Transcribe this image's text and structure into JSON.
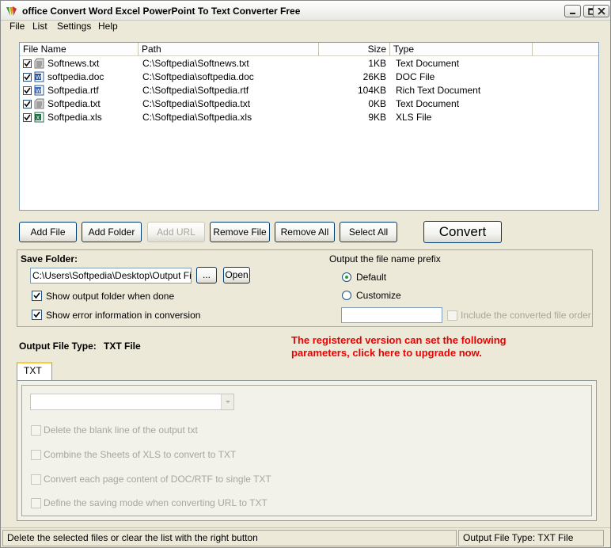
{
  "window": {
    "title": "office Convert Word Excel PowerPoint To Text Converter Free"
  },
  "menu": [
    "File",
    "List",
    "Settings",
    "Help"
  ],
  "file_list": {
    "columns": [
      "File Name",
      "Path",
      "Size",
      "Type"
    ],
    "rows": [
      {
        "name": "Softnews.txt",
        "path": "C:\\Softpedia\\Softnews.txt",
        "size": "1KB",
        "type": "Text Document",
        "icon": "text-file-icon",
        "checked": true
      },
      {
        "name": "softpedia.doc",
        "path": "C:\\Softpedia\\softpedia.doc",
        "size": "26KB",
        "type": "DOC File",
        "icon": "word-file-icon",
        "checked": true
      },
      {
        "name": "Softpedia.rtf",
        "path": "C:\\Softpedia\\Softpedia.rtf",
        "size": "104KB",
        "type": "Rich Text Document",
        "icon": "rtf-file-icon",
        "checked": true
      },
      {
        "name": "Softpedia.txt",
        "path": "C:\\Softpedia\\Softpedia.txt",
        "size": "0KB",
        "type": "Text Document",
        "icon": "text-file-icon",
        "checked": true
      },
      {
        "name": "Softpedia.xls",
        "path": "C:\\Softpedia\\Softpedia.xls",
        "size": "9KB",
        "type": "XLS File",
        "icon": "excel-file-icon",
        "checked": true
      }
    ]
  },
  "buttons": {
    "add_file": "Add File",
    "add_folder": "Add Folder",
    "add_url": "Add URL",
    "remove_file": "Remove File",
    "remove_all": "Remove All",
    "select_all": "Select All",
    "convert": "Convert"
  },
  "save_folder": {
    "label": "Save Folder:",
    "path": "C:\\Users\\Softpedia\\Desktop\\Output Files",
    "browse": "...",
    "open": "Open",
    "show_output": "Show output folder when done",
    "show_output_checked": true,
    "show_errors": "Show error information in conversion",
    "show_errors_checked": true
  },
  "prefix": {
    "label": "Output the file name prefix",
    "option_default": "Default",
    "option_customize": "Customize",
    "selected": "Default",
    "custom_value": "",
    "include_order": "Include the converted file order",
    "include_order_checked": false
  },
  "output_type": {
    "label": "Output File Type:",
    "value": "TXT File"
  },
  "upgrade_note": "The registered version can set the following parameters, click here to upgrade now.",
  "tabs": [
    "TXT"
  ],
  "txt_options": {
    "combo_value": "",
    "options": [
      "Delete the blank line of the output txt",
      "Combine the Sheets of XLS to convert to TXT",
      "Convert each page content of DOC/RTF to single TXT",
      "Define the saving mode when converting URL to TXT"
    ]
  },
  "status": {
    "hint": "Delete the selected files or clear the list with the right button",
    "output_type": "Output File Type:   TXT File"
  }
}
